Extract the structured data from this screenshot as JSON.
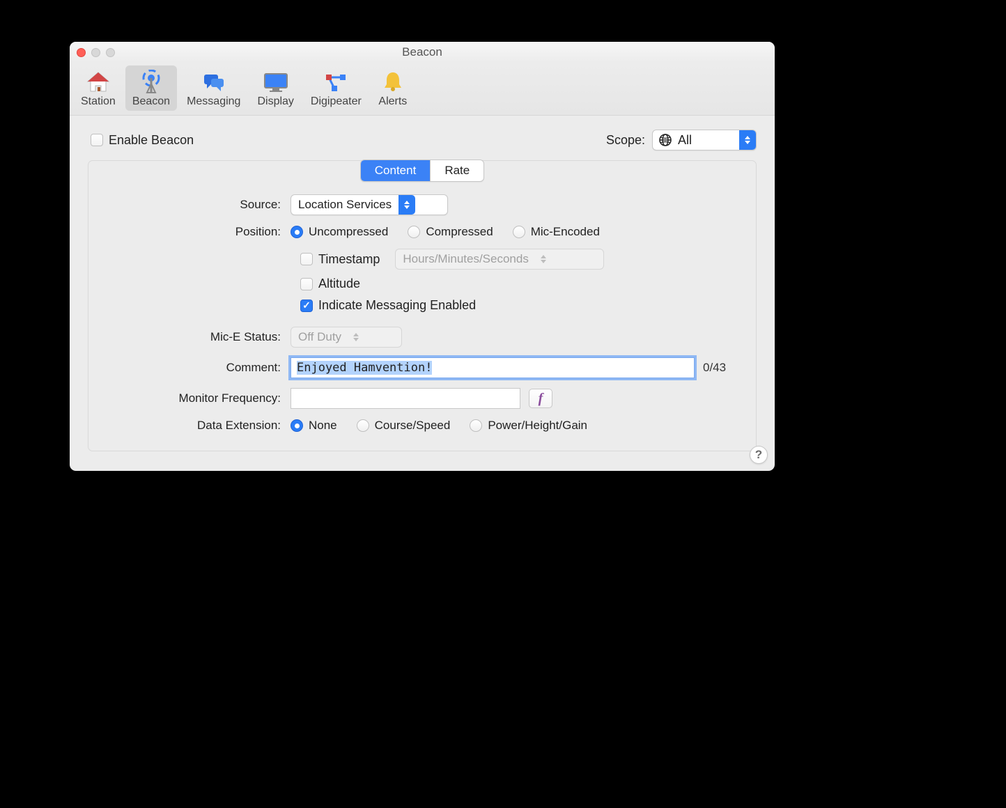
{
  "window": {
    "title": "Beacon"
  },
  "toolbar": {
    "items": [
      {
        "label": "Station"
      },
      {
        "label": "Beacon"
      },
      {
        "label": "Messaging"
      },
      {
        "label": "Display"
      },
      {
        "label": "Digipeater"
      },
      {
        "label": "Alerts"
      }
    ],
    "selected": "Beacon"
  },
  "enable_beacon": {
    "label": "Enable Beacon",
    "checked": false
  },
  "scope": {
    "label": "Scope:",
    "value": "All"
  },
  "tabs": {
    "content": "Content",
    "rate": "Rate",
    "active": "Content"
  },
  "form": {
    "source": {
      "label": "Source:",
      "value": "Location Services"
    },
    "position": {
      "label": "Position:",
      "options": {
        "uncompressed": "Uncompressed",
        "compressed": "Compressed",
        "mic": "Mic-Encoded"
      },
      "selected": "uncompressed"
    },
    "timestamp": {
      "label": "Timestamp",
      "checked": false,
      "format": "Hours/Minutes/Seconds"
    },
    "altitude": {
      "label": "Altitude",
      "checked": false
    },
    "messaging": {
      "label": "Indicate Messaging Enabled",
      "checked": true
    },
    "mic_status": {
      "label": "Mic-E Status:",
      "value": "Off Duty"
    },
    "comment": {
      "label": "Comment:",
      "value": "Enjoyed Hamvention!",
      "counter": "0/43"
    },
    "monitor": {
      "label": "Monitor Frequency:",
      "value": "",
      "button_glyph": "f"
    },
    "data_ext": {
      "label": "Data Extension:",
      "options": {
        "none": "None",
        "course": "Course/Speed",
        "phg": "Power/Height/Gain"
      },
      "selected": "none"
    }
  },
  "help_glyph": "?"
}
